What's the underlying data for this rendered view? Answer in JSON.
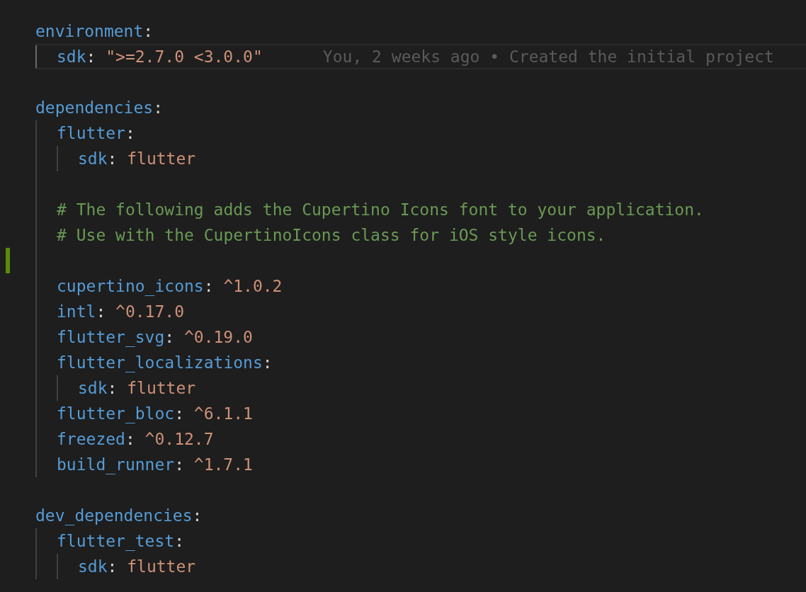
{
  "editor": {
    "lines": [
      {
        "kind": "key",
        "key": "environment",
        "punct": ":",
        "current": false,
        "modified": false,
        "children": [
          {
            "kind": "key",
            "key": "sdk",
            "punct": ":",
            "value": "\">=2.7.0 <3.0.0\"",
            "current": true,
            "modified": false,
            "blame": "You, 2 weeks ago • Created the initial project"
          }
        ]
      },
      {
        "kind": "blank",
        "current": false,
        "modified": false
      },
      {
        "kind": "key",
        "key": "dependencies",
        "punct": ":",
        "current": false,
        "modified": false,
        "children": [
          {
            "kind": "key",
            "key": "flutter",
            "punct": ":",
            "current": false,
            "modified": false,
            "children": [
              {
                "kind": "key",
                "key": "sdk",
                "punct": ":",
                "value": "flutter",
                "current": false,
                "modified": false
              }
            ]
          },
          {
            "kind": "blank",
            "current": false,
            "modified": false
          },
          {
            "kind": "comment",
            "text": "# The following adds the Cupertino Icons font to your application.",
            "current": false,
            "modified": false
          },
          {
            "kind": "comment",
            "text": "# Use with the CupertinoIcons class for iOS style icons.",
            "current": false,
            "modified": false
          },
          {
            "kind": "blank",
            "current": false,
            "modified": true
          },
          {
            "kind": "key",
            "key": "cupertino_icons",
            "punct": ":",
            "value": "^1.0.2",
            "current": false,
            "modified": false
          },
          {
            "kind": "key",
            "key": "intl",
            "punct": ":",
            "value": "^0.17.0",
            "current": false,
            "modified": false
          },
          {
            "kind": "key",
            "key": "flutter_svg",
            "punct": ":",
            "value": "^0.19.0",
            "current": false,
            "modified": false
          },
          {
            "kind": "key",
            "key": "flutter_localizations",
            "punct": ":",
            "current": false,
            "modified": false,
            "children": [
              {
                "kind": "key",
                "key": "sdk",
                "punct": ":",
                "value": "flutter",
                "current": false,
                "modified": false
              }
            ]
          },
          {
            "kind": "key",
            "key": "flutter_bloc",
            "punct": ":",
            "value": "^6.1.1",
            "current": false,
            "modified": false
          },
          {
            "kind": "key",
            "key": "freezed",
            "punct": ":",
            "value": "^0.12.7",
            "current": false,
            "modified": false
          },
          {
            "kind": "key",
            "key": "build_runner",
            "punct": ":",
            "value": "^1.7.1",
            "current": false,
            "modified": false
          }
        ]
      },
      {
        "kind": "blank",
        "current": false,
        "modified": false
      },
      {
        "kind": "key",
        "key": "dev_dependencies",
        "punct": ":",
        "current": false,
        "modified": false,
        "children": [
          {
            "kind": "key",
            "key": "flutter_test",
            "punct": ":",
            "current": false,
            "modified": false,
            "children": [
              {
                "kind": "key",
                "key": "sdk",
                "punct": ":",
                "value": "flutter",
                "current": false,
                "modified": false
              }
            ]
          }
        ]
      }
    ]
  }
}
